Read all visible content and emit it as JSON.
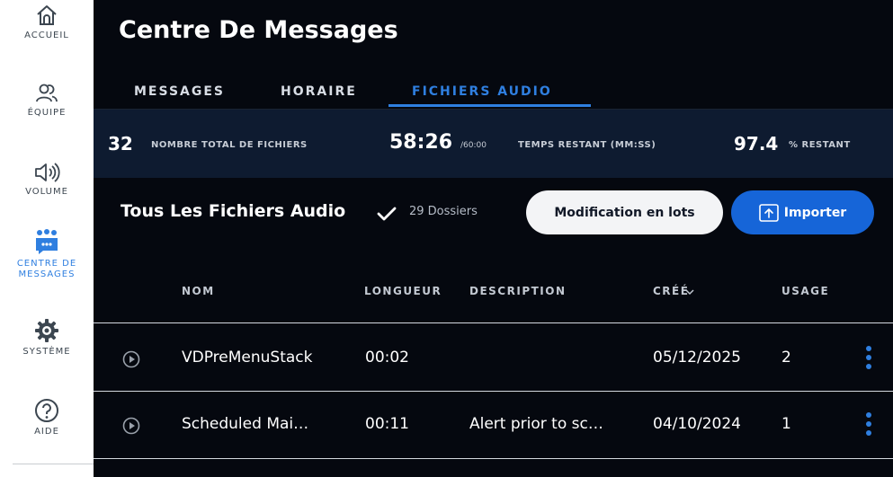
{
  "sidebar": {
    "items": [
      {
        "label": "ACCUEIL",
        "icon": "home-icon"
      },
      {
        "label": "ÉQUIPE",
        "icon": "team-icon"
      },
      {
        "label": "VOLUME",
        "icon": "volume-icon"
      },
      {
        "label": "CENTRE DE MESSAGES",
        "icon": "message-center-icon",
        "active": true
      },
      {
        "label": "SYSTÈME",
        "icon": "gear-icon"
      },
      {
        "label": "AIDE",
        "icon": "help-icon"
      }
    ]
  },
  "header": {
    "title": "Centre De Messages"
  },
  "tabs": [
    {
      "label": "MESSAGES"
    },
    {
      "label": "HORAIRE"
    },
    {
      "label": "FICHIERS AUDIO",
      "active": true
    }
  ],
  "stats": {
    "total_files": "32",
    "total_files_label": "NOMBRE TOTAL DE FICHIERS",
    "time_remaining": "58:26",
    "time_total": "/60:00",
    "time_label": "TEMPS RESTANT (MM:SS)",
    "percent": "97.4",
    "percent_label": "% RESTANT"
  },
  "toolbar": {
    "filter_label": "Tous Les Fichiers Audio",
    "folders": "29 Dossiers",
    "batch_label": "Modification en lots",
    "import_label": "Importer"
  },
  "table": {
    "columns": [
      "NOM",
      "LONGUEUR",
      "DESCRIPTION",
      "CRÉÉ",
      "USAGE"
    ],
    "rows": [
      {
        "name": "VDPreMenuStack",
        "length": "00:02",
        "description": "",
        "created": "05/12/2025",
        "usage": "2"
      },
      {
        "name": "Scheduled Mai…",
        "length": "00:11",
        "description": "Alert prior to sc…",
        "created": "04/10/2024",
        "usage": "1"
      }
    ]
  },
  "colors": {
    "accent": "#2f7fe0",
    "background": "#05080f",
    "stats_bar": "#0e1b30",
    "import_button": "#1665d8"
  }
}
